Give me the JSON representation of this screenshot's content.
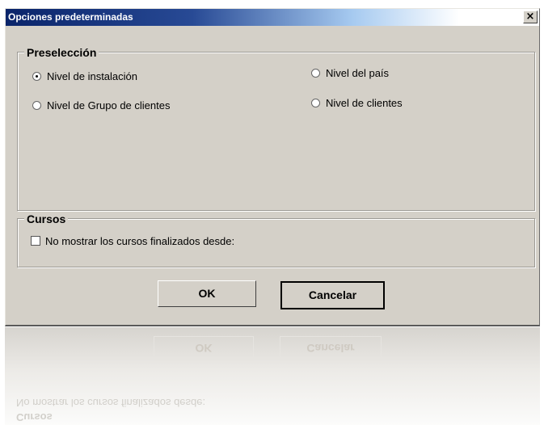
{
  "window": {
    "title": "Opciones predeterminadas",
    "close_glyph": "×"
  },
  "preseleccion": {
    "legend": "Preselección",
    "options": [
      {
        "label": "Nivel de instalación",
        "checked": true
      },
      {
        "label": "Nivel del país",
        "checked": false
      },
      {
        "label": "Nivel de Grupo de clientes",
        "checked": false
      },
      {
        "label": "Nivel de clientes",
        "checked": false
      }
    ]
  },
  "cursos": {
    "legend": "Cursos",
    "checkbox_label": "No mostrar los cursos finalizados desde:",
    "checked": false
  },
  "buttons": {
    "ok": "OK",
    "cancel": "Cancelar"
  },
  "reflection": {
    "ok": "OK",
    "cancel": "Cancelar",
    "checkbox_label": "No mostrar los cursos finalizados desde:",
    "legend": "Cursos"
  },
  "colors": {
    "dialog_bg": "#d4d0c8",
    "titlebar_start": "#0a246a"
  }
}
